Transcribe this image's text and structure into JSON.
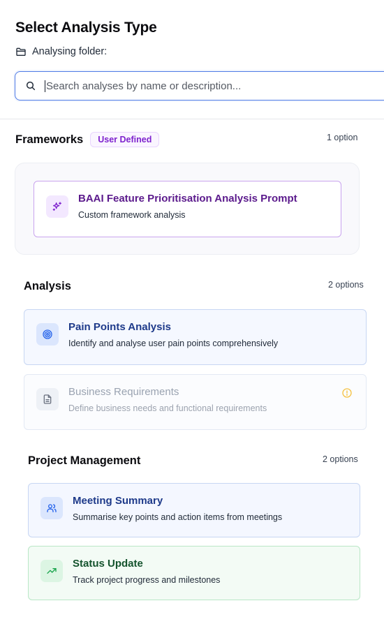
{
  "header": {
    "title": "Select Analysis Type",
    "folder_label": "Analysing folder:"
  },
  "search": {
    "placeholder": "Search analyses by name or description...",
    "value": ""
  },
  "sections": [
    {
      "name": "Frameworks",
      "badge": "User Defined",
      "count": "1 option",
      "items": [
        {
          "title": "BAAI Feature Prioritisation Analysis Prompt",
          "description": "Custom framework analysis",
          "icon": "sparkles-icon",
          "accent": "#7e22ce"
        }
      ]
    },
    {
      "name": "Analysis",
      "count": "2 options",
      "items": [
        {
          "title": "Pain Points Analysis",
          "description": "Identify and analyse user pain points comprehensively",
          "icon": "target-icon",
          "accent": "#2563eb"
        },
        {
          "title": "Business Requirements",
          "description": "Define business needs and functional requirements",
          "icon": "document-icon",
          "accent": "#9ca3af",
          "status_icon": "warning-circle-icon",
          "status_color": "#f5c242"
        }
      ]
    },
    {
      "name": "Project Management",
      "count": "2 options",
      "items": [
        {
          "title": "Meeting Summary",
          "description": "Summarise key points and action items from meetings",
          "icon": "users-icon",
          "accent": "#2563eb"
        },
        {
          "title": "Status Update",
          "description": "Track project progress and milestones",
          "icon": "trending-up-icon",
          "accent": "#16a34a"
        }
      ]
    }
  ]
}
